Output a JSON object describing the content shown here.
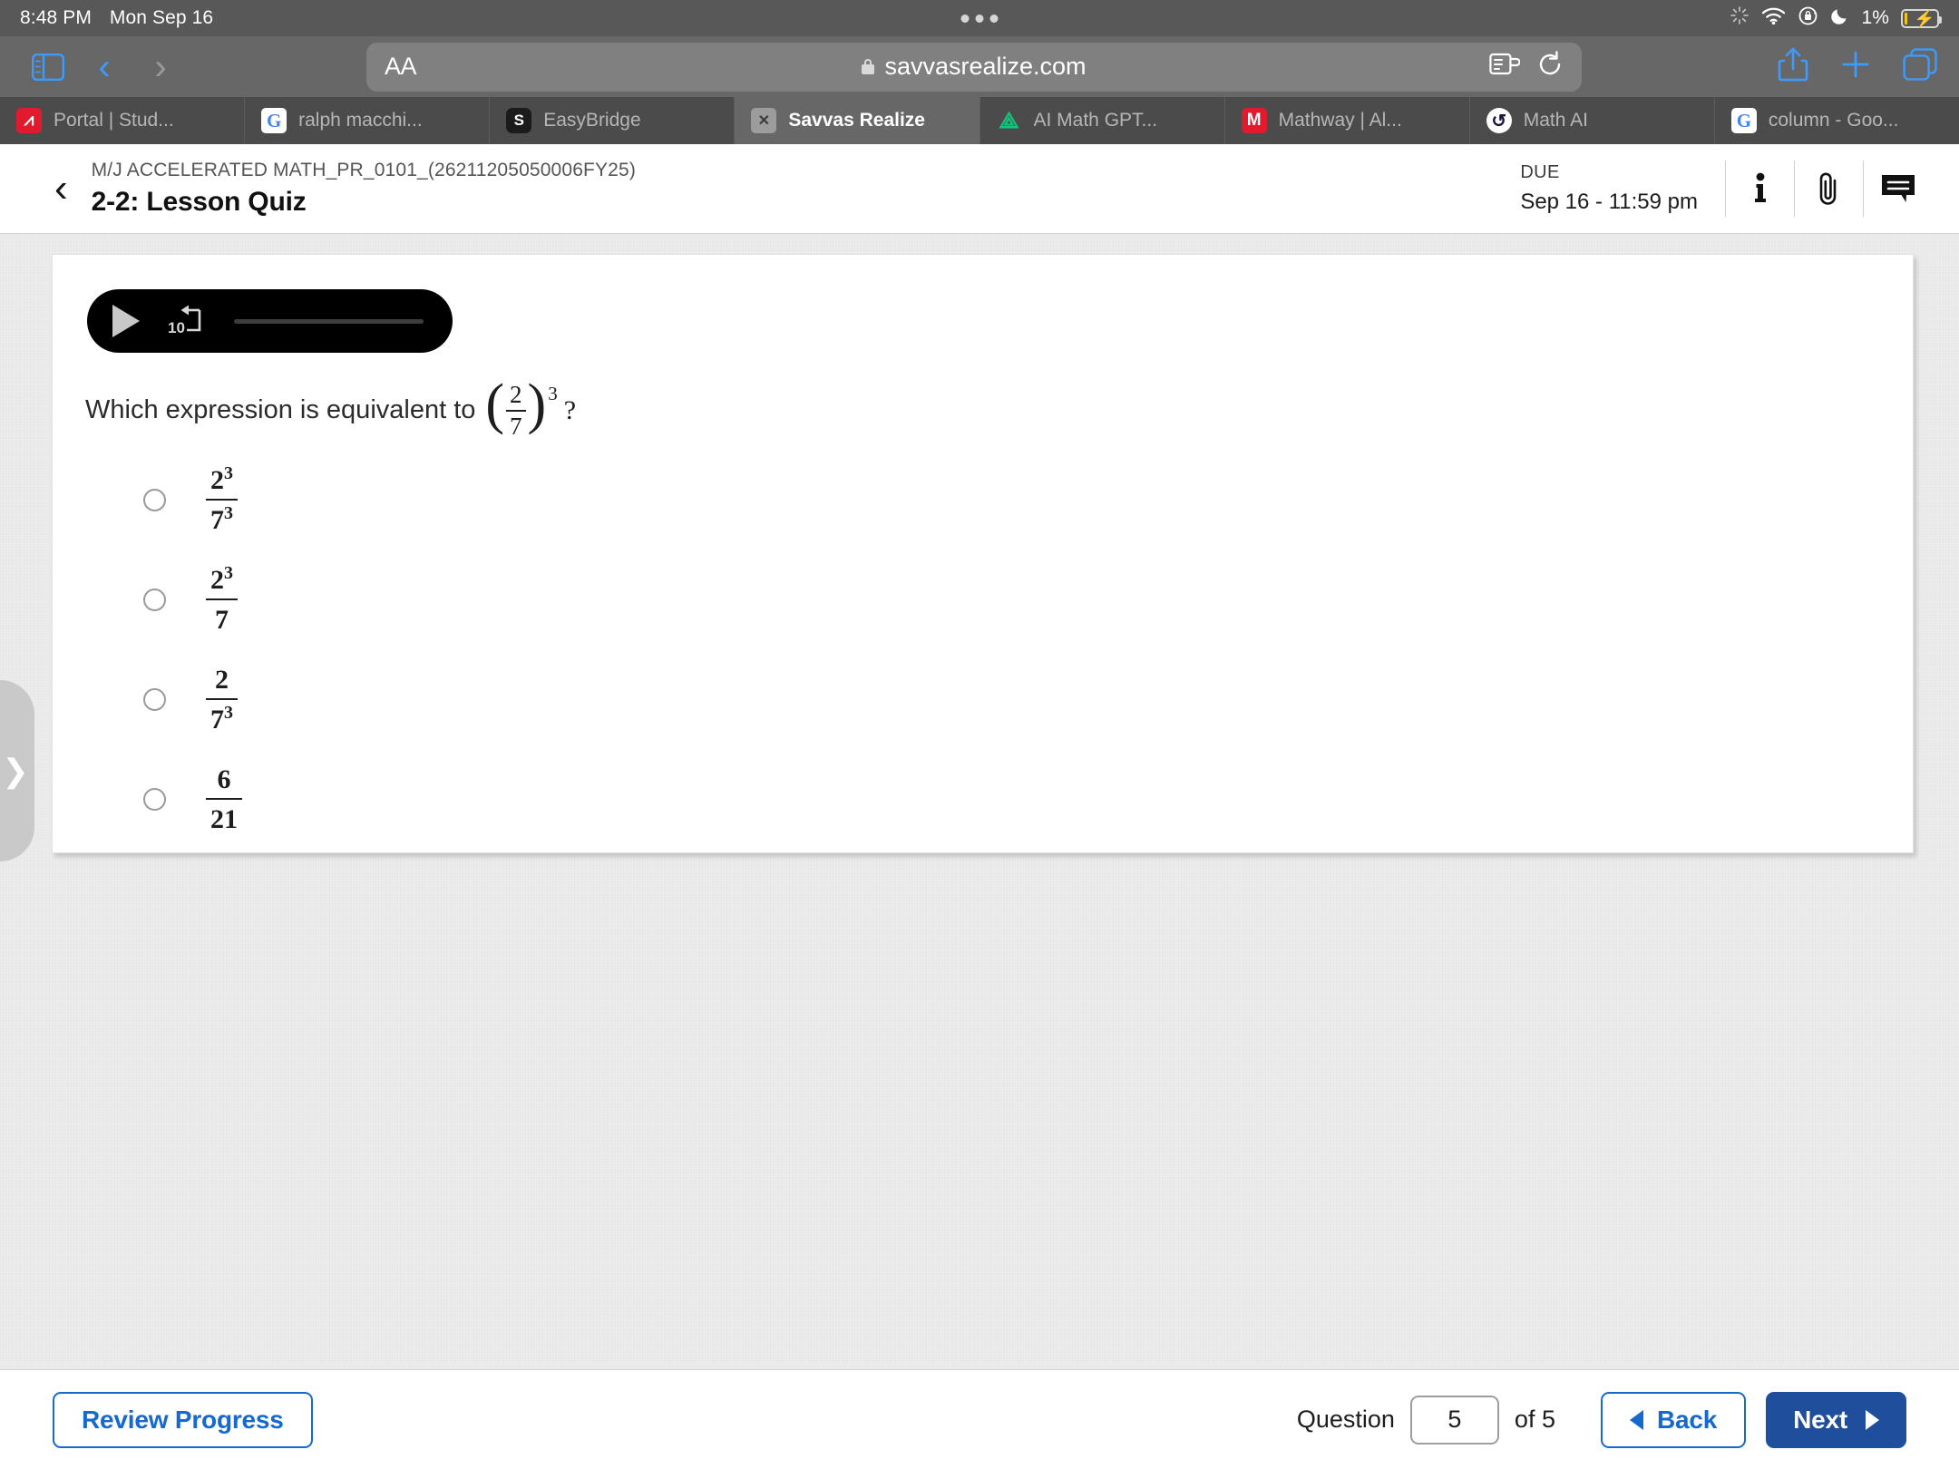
{
  "statusbar": {
    "time": "8:48 PM",
    "date": "Mon Sep 16",
    "battery_percent": "1%",
    "icons": [
      "brightness-icon",
      "wifi-icon",
      "rotation-lock-icon",
      "do-not-disturb-icon",
      "battery-charging-icon"
    ]
  },
  "browser": {
    "url": "savvasrealize.com",
    "text_size_label": "AA",
    "icons": [
      "sidebar-icon",
      "back-icon",
      "forward-icon",
      "lock-icon",
      "reader-icon",
      "reload-icon",
      "share-icon",
      "new-tab-icon",
      "tabs-icon"
    ],
    "tabs": [
      {
        "label": "Portal | Stud...",
        "favicon": "powerschool-icon",
        "active": false
      },
      {
        "label": "ralph macchi...",
        "favicon": "google-icon",
        "active": false
      },
      {
        "label": "EasyBridge",
        "favicon": "easybridge-icon",
        "active": false
      },
      {
        "label": "Savvas Realize",
        "favicon": "close-icon",
        "active": true
      },
      {
        "label": "AI Math GPT...",
        "favicon": "compass-icon",
        "active": false
      },
      {
        "label": "Mathway | Al...",
        "favicon": "mathway-icon",
        "active": false
      },
      {
        "label": "Math AI",
        "favicon": "mathai-icon",
        "active": false
      },
      {
        "label": "column - Goo...",
        "favicon": "google-icon",
        "active": false
      }
    ]
  },
  "header": {
    "back_label": "‹",
    "course": "M/J ACCELERATED MATH_PR_0101_(26211205050006FY25)",
    "lesson_title": "2-2: Lesson Quiz",
    "due_label": "DUE",
    "due_value": "Sep 16 - 11:59 pm",
    "icons": [
      "info-icon",
      "attachment-icon",
      "comment-icon"
    ]
  },
  "player": {
    "play_label": "play-icon",
    "rewind_seconds": "10"
  },
  "question": {
    "prompt": "Which expression is equivalent to",
    "expr_numerator": "2",
    "expr_denominator": "7",
    "expr_exponent": "3",
    "question_mark": "?",
    "choices": [
      {
        "numerator": "2",
        "num_exp": "3",
        "denominator": "7",
        "den_exp": "3",
        "selected": false
      },
      {
        "numerator": "2",
        "num_exp": "3",
        "denominator": "7",
        "den_exp": "",
        "selected": false
      },
      {
        "numerator": "2",
        "num_exp": "",
        "denominator": "7",
        "den_exp": "3",
        "selected": false
      },
      {
        "numerator": "6",
        "num_exp": "",
        "denominator": "21",
        "den_exp": "",
        "selected": false
      }
    ]
  },
  "drawer": {
    "handle_icon": "chevron-right-icon"
  },
  "footer": {
    "review_progress": "Review Progress",
    "question_label": "Question",
    "question_number": "5",
    "of_label": "of 5",
    "back_label": "Back",
    "next_label": "Next"
  },
  "colors": {
    "accent_blue": "#1669cd",
    "next_blue": "#1f4e9c",
    "chrome_gray": "#676767",
    "tabstrip_gray": "#4b4b4b",
    "content_gray": "#ececec"
  }
}
